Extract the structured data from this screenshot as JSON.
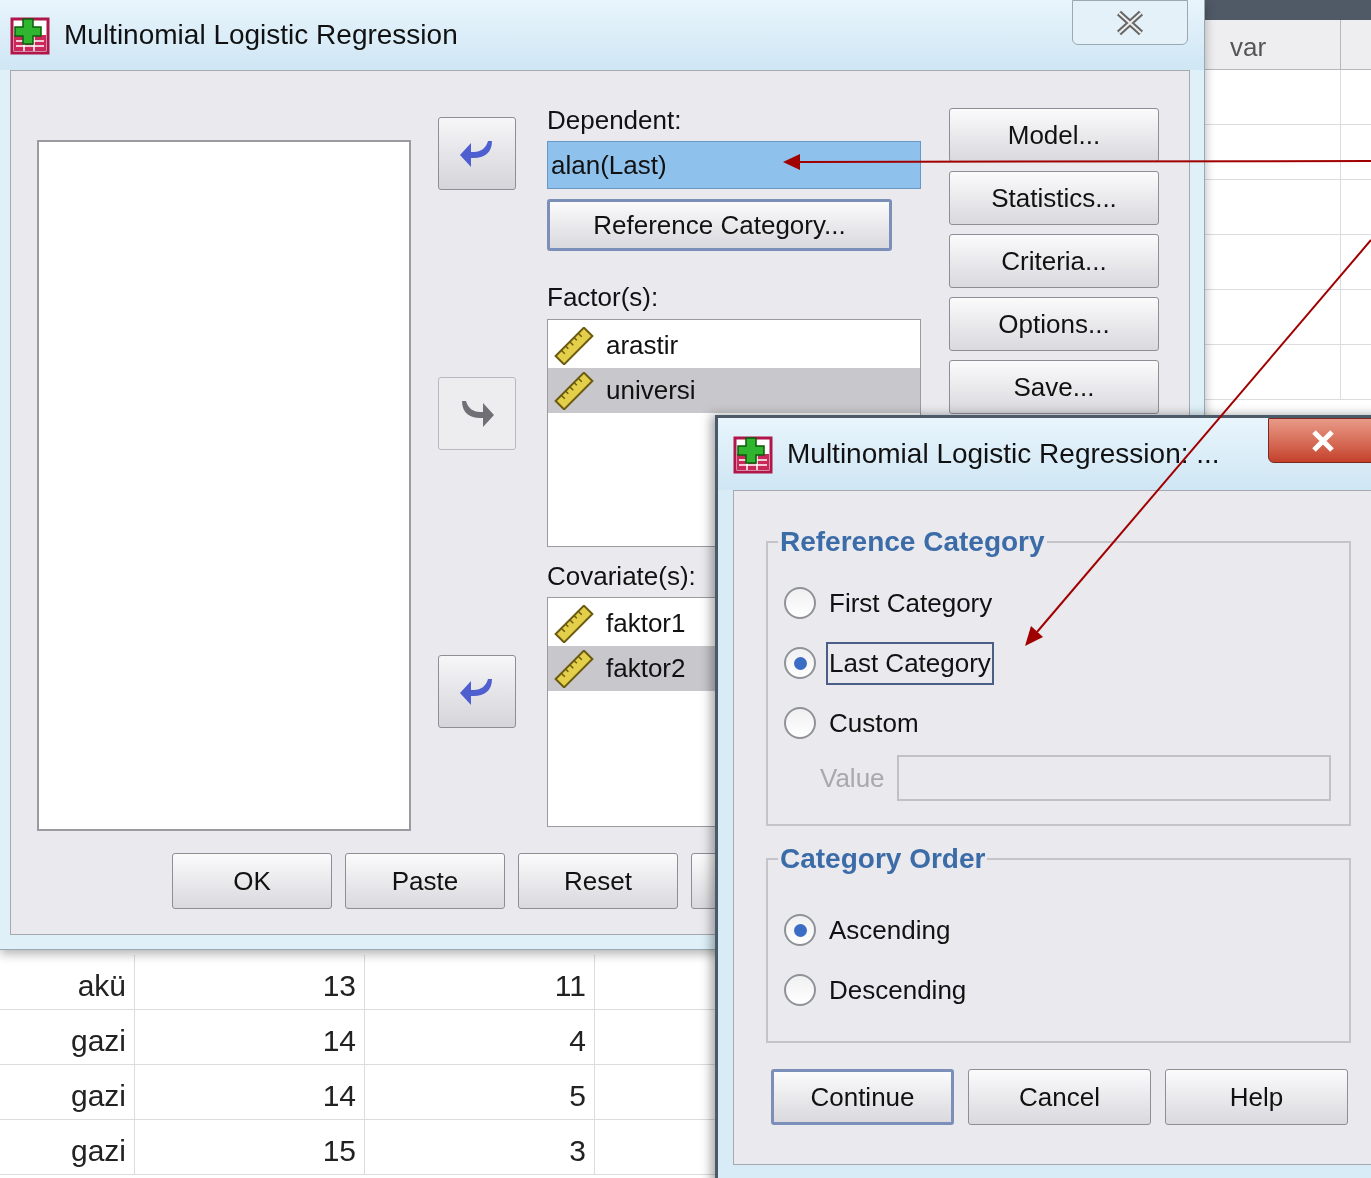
{
  "data_view": {
    "column_header": "var",
    "rows": [
      [
        "akü",
        "13",
        "11"
      ],
      [
        "gazi",
        "14",
        "4"
      ],
      [
        "gazi",
        "14",
        "5"
      ],
      [
        "gazi",
        "15",
        "3"
      ]
    ]
  },
  "main_dialog": {
    "title": "Multinomial Logistic Regression",
    "arrow_buttons": [
      {
        "kind": "back",
        "disabled": false
      },
      {
        "kind": "forward",
        "disabled": true
      },
      {
        "kind": "back",
        "disabled": false
      }
    ],
    "dependent": {
      "label": "Dependent:",
      "value": "alan(Last)"
    },
    "reference_button": {
      "label": "Reference Category...",
      "focused": true
    },
    "factors": {
      "label": "Factor(s):",
      "items": [
        {
          "name": "arastir",
          "selected": false
        },
        {
          "name": "universi",
          "selected": true
        }
      ]
    },
    "covariates": {
      "label": "Covariate(s):",
      "items": [
        {
          "name": "faktor1",
          "selected": false
        },
        {
          "name": "faktor2",
          "selected": true
        }
      ]
    },
    "side_buttons": [
      "Model...",
      "Statistics...",
      "Criteria...",
      "Options...",
      "Save..."
    ],
    "bottom_buttons": [
      "OK",
      "Paste",
      "Reset"
    ]
  },
  "sub_dialog": {
    "title": "Multinomial Logistic Regression: ...",
    "reference_group": {
      "legend": "Reference Category",
      "options": [
        {
          "label": "First Category",
          "selected": false,
          "focused": false
        },
        {
          "label": "Last Category",
          "selected": true,
          "focused": true
        },
        {
          "label": "Custom",
          "selected": false,
          "focused": false
        }
      ],
      "value_field": {
        "label": "Value",
        "disabled": true
      }
    },
    "order_group": {
      "legend": "Category Order",
      "options": [
        {
          "label": "Ascending",
          "selected": true,
          "focused": false
        },
        {
          "label": "Descending",
          "selected": false,
          "focused": false
        }
      ]
    },
    "buttons": [
      {
        "label": "Continue",
        "default": true
      },
      {
        "label": "Cancel",
        "default": false
      },
      {
        "label": "Help",
        "default": false
      }
    ]
  }
}
